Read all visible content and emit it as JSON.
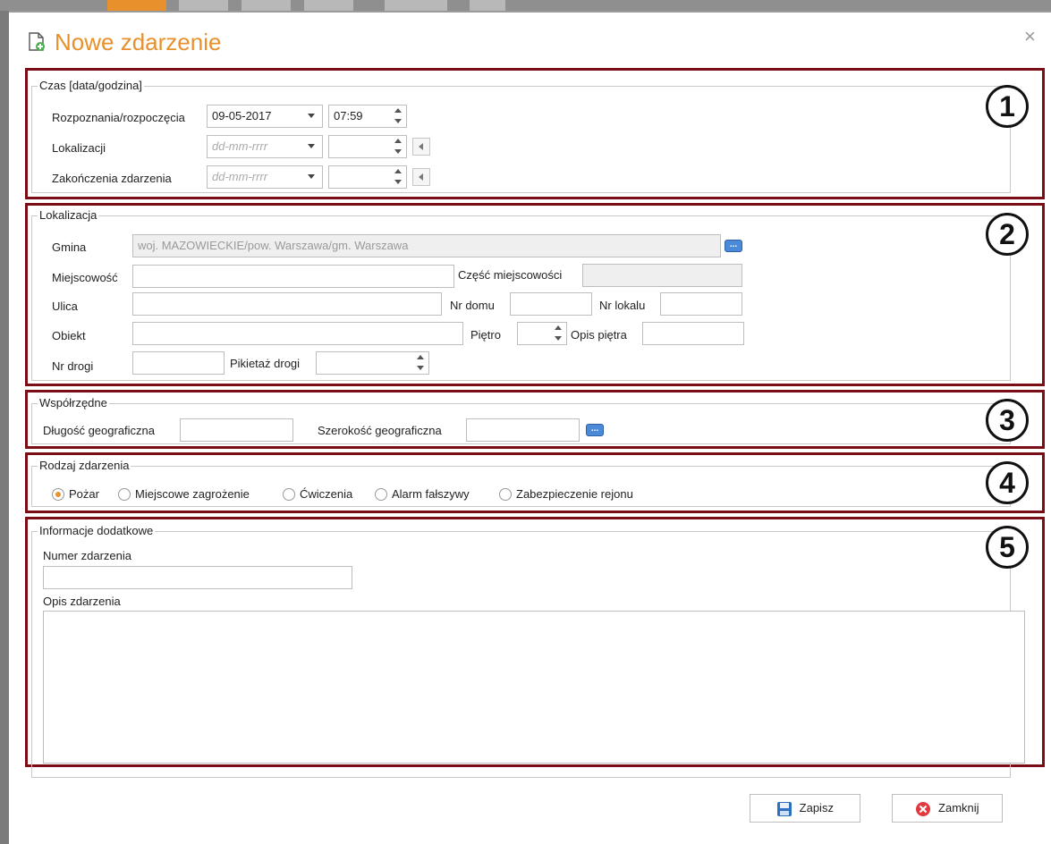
{
  "dialog": {
    "title": "Nowe zdarzenie",
    "close_icon": "×"
  },
  "section_numbers": [
    "1",
    "2",
    "3",
    "4",
    "5"
  ],
  "czas": {
    "legend": "Czas [data/godzina]",
    "rows": [
      {
        "label": "Rozpoznania/rozpoczęcia",
        "date": "09-05-2017",
        "time": "07:59"
      },
      {
        "label": "Lokalizacji",
        "date_placeholder": "dd-mm-rrrr",
        "time": ""
      },
      {
        "label": "Zakończenia zdarzenia",
        "date_placeholder": "dd-mm-rrrr",
        "time": ""
      }
    ]
  },
  "lokalizacja": {
    "legend": "Lokalizacja",
    "gmina_label": "Gmina",
    "gmina_value": "woj. MAZOWIECKIE/pow. Warszawa/gm. Warszawa",
    "miejscowosc_label": "Miejscowość",
    "czesc_label": "Część miejscowości",
    "ulica_label": "Ulica",
    "nr_domu_label": "Nr domu",
    "nr_lokalu_label": "Nr lokalu",
    "obiekt_label": "Obiekt",
    "pietro_label": "Piętro",
    "opis_pietra_label": "Opis piętra",
    "nr_drogi_label": "Nr drogi",
    "pikietaz_label": "Pikietaż drogi"
  },
  "wspolrzedne": {
    "legend": "Współrzędne",
    "dlugosc_label": "Długość geograficzna",
    "szerokosc_label": "Szerokość geograficzna"
  },
  "rodzaj": {
    "legend": "Rodzaj zdarzenia",
    "options": [
      "Pożar",
      "Miejscowe zagrożenie",
      "Ćwiczenia",
      "Alarm fałszywy",
      "Zabezpieczenie rejonu"
    ],
    "selected": "Pożar"
  },
  "informacje": {
    "legend": "Informacje dodatkowe",
    "numer_label": "Numer zdarzenia",
    "opis_label": "Opis zdarzenia"
  },
  "buttons": {
    "save": "Zapisz",
    "close": "Zamknij"
  },
  "colors": {
    "accent": "#e8902c",
    "annotation_red": "#7a0d15"
  }
}
